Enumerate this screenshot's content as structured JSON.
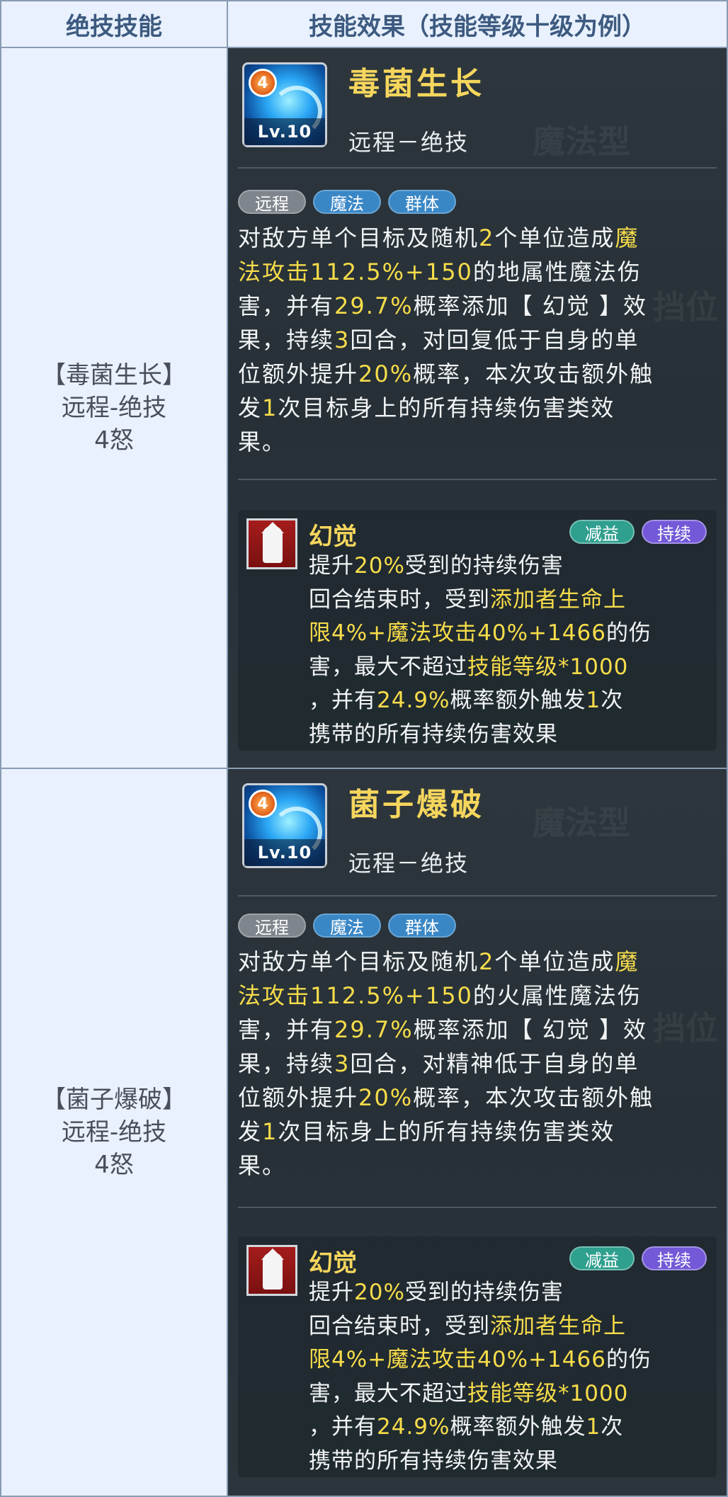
{
  "header": {
    "col1": "绝技技能",
    "col2": "技能效果（技能等级十级为例）"
  },
  "rows": [
    {
      "left": {
        "line1": "【毒菌生长】",
        "line2": "远程-绝技",
        "line3": "4怒"
      },
      "skill": {
        "badge": "4",
        "level": "Lv.10",
        "name": "毒菌生长",
        "sub": "远程－绝技",
        "tags": [
          "远程",
          "魔法",
          "群体"
        ],
        "desc": [
          [
            {
              "t": "对敌方单个目标及随机"
            },
            {
              "t": "2",
              "h": true
            },
            {
              "t": "个单位造成"
            },
            {
              "t": "魔",
              "h": true
            }
          ],
          [
            {
              "t": "法攻击112.5%+150",
              "h": true
            },
            {
              "t": "的地属性魔法伤"
            }
          ],
          [
            {
              "t": "害，并有"
            },
            {
              "t": "29.7%",
              "h": true
            },
            {
              "t": "概率添加【 幻觉 】效"
            }
          ],
          [
            {
              "t": "果，持续"
            },
            {
              "t": "3",
              "h": true
            },
            {
              "t": "回合，对回复低于自身的单"
            }
          ],
          [
            {
              "t": "位额外提升"
            },
            {
              "t": "20%",
              "h": true
            },
            {
              "t": "概率，本次攻击额外触"
            }
          ],
          [
            {
              "t": "发"
            },
            {
              "t": "1",
              "h": true
            },
            {
              "t": "次目标身上的所有持续伤害类效"
            }
          ],
          [
            {
              "t": "果。"
            }
          ]
        ],
        "buff": {
          "name": "幻觉",
          "tags": [
            "减益",
            "持续"
          ],
          "desc": [
            [
              {
                "t": "提升"
              },
              {
                "t": "20%",
                "h": true
              },
              {
                "t": "受到的持续伤害"
              }
            ],
            [
              {
                "t": "回合结束时，受到"
              },
              {
                "t": "添加者生命上",
                "h": true
              }
            ],
            [
              {
                "t": "限4%+魔法攻击40%+1466",
                "h": true
              },
              {
                "t": "的伤"
              }
            ],
            [
              {
                "t": "害，最大不超过"
              },
              {
                "t": "技能等级*1000",
                "h": true
              }
            ],
            [
              {
                "t": "，并有"
              },
              {
                "t": "24.9%",
                "h": true
              },
              {
                "t": "概率额外触发"
              },
              {
                "t": "1",
                "h": true
              },
              {
                "t": "次"
              }
            ],
            [
              {
                "t": "携带的所有持续伤害效果"
              }
            ]
          ]
        }
      }
    },
    {
      "left": {
        "line1": "【菌子爆破】",
        "line2": "远程-绝技",
        "line3": "4怒"
      },
      "skill": {
        "badge": "4",
        "level": "Lv.10",
        "name": "菌子爆破",
        "sub": "远程－绝技",
        "tags": [
          "远程",
          "魔法",
          "群体"
        ],
        "desc": [
          [
            {
              "t": "对敌方单个目标及随机"
            },
            {
              "t": "2",
              "h": true
            },
            {
              "t": "个单位造成"
            },
            {
              "t": "魔",
              "h": true
            }
          ],
          [
            {
              "t": "法攻击112.5%+150",
              "h": true
            },
            {
              "t": "的火属性魔法伤"
            }
          ],
          [
            {
              "t": "害，并有"
            },
            {
              "t": "29.7%",
              "h": true
            },
            {
              "t": "概率添加【 幻觉 】效"
            }
          ],
          [
            {
              "t": "果，持续"
            },
            {
              "t": "3",
              "h": true
            },
            {
              "t": "回合，对精神低于自身的单"
            }
          ],
          [
            {
              "t": "位额外提升"
            },
            {
              "t": "20%",
              "h": true
            },
            {
              "t": "概率，本次攻击额外触"
            }
          ],
          [
            {
              "t": "发"
            },
            {
              "t": "1",
              "h": true
            },
            {
              "t": "次目标身上的所有持续伤害类效"
            }
          ],
          [
            {
              "t": "果。"
            }
          ]
        ],
        "buff": {
          "name": "幻觉",
          "tags": [
            "减益",
            "持续"
          ],
          "desc": [
            [
              {
                "t": "提升"
              },
              {
                "t": "20%",
                "h": true
              },
              {
                "t": "受到的持续伤害"
              }
            ],
            [
              {
                "t": "回合结束时，受到"
              },
              {
                "t": "添加者生命上",
                "h": true
              }
            ],
            [
              {
                "t": "限4%+魔法攻击40%+1466",
                "h": true
              },
              {
                "t": "的伤"
              }
            ],
            [
              {
                "t": "害，最大不超过"
              },
              {
                "t": "技能等级*1000",
                "h": true
              }
            ],
            [
              {
                "t": "，并有"
              },
              {
                "t": "24.9%",
                "h": true
              },
              {
                "t": "概率额外触发"
              },
              {
                "t": "1",
                "h": true
              },
              {
                "t": "次"
              }
            ],
            [
              {
                "t": "携带的所有持续伤害效果"
              }
            ]
          ]
        }
      }
    }
  ]
}
